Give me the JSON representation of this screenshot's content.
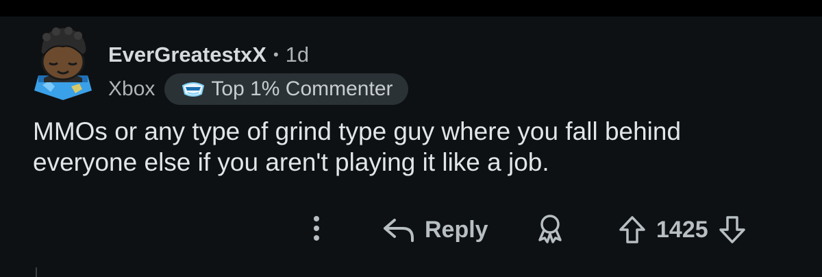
{
  "comment": {
    "username": "EverGreatestxX",
    "separator": "•",
    "age": "1d",
    "flair": "Xbox",
    "badge_label": "Top 1% Commenter",
    "body_line1": "MMOs or any type of grind type guy where you fall behind",
    "body_line2": "everyone else if you aren't playing it like a job."
  },
  "actions": {
    "reply_label": "Reply",
    "score": "1425"
  },
  "icons": {
    "more": "more-vertical-icon",
    "reply": "reply-arrow-icon",
    "award": "award-icon",
    "upvote": "upvote-arrow-icon",
    "downvote": "downvote-arrow-icon",
    "badge": "top-commenter-icon"
  },
  "colors": {
    "background": "#0e1113",
    "text": "#d7dadc",
    "muted": "#aeb4b8",
    "badge_bg": "#2a3236"
  }
}
